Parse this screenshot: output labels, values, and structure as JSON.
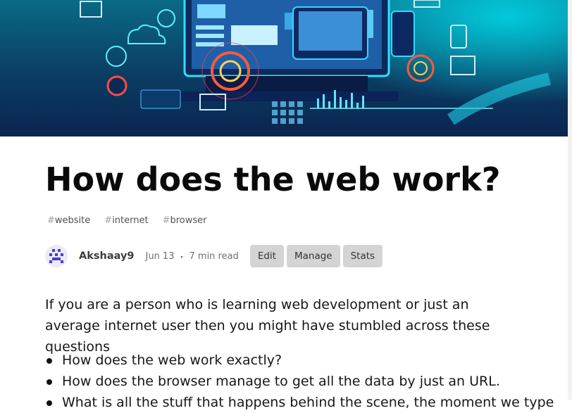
{
  "article": {
    "title": "How does the web work?",
    "tags": [
      {
        "hash": "#",
        "label": "website"
      },
      {
        "hash": "#",
        "label": "internet"
      },
      {
        "hash": "#",
        "label": "browser"
      }
    ],
    "author": "Akshaay9",
    "date": "Jun 13",
    "separator": "・",
    "read_time": "7 min read",
    "buttons": {
      "edit": "Edit",
      "manage": "Manage",
      "stats": "Stats"
    },
    "intro": "If you are a person who is learning web development or just an average internet user then you might have stumbled across these questions",
    "bullets": [
      "How does the web work exactly?",
      "How does the browser manage to get all the data by just an URL.",
      "What is all the stuff that happens behind the scene, the moment we type"
    ]
  },
  "cover": {
    "colors": {
      "primary": "#0b3d62",
      "accent": "#00d8e8",
      "highlight": "#ff4a4a"
    }
  }
}
